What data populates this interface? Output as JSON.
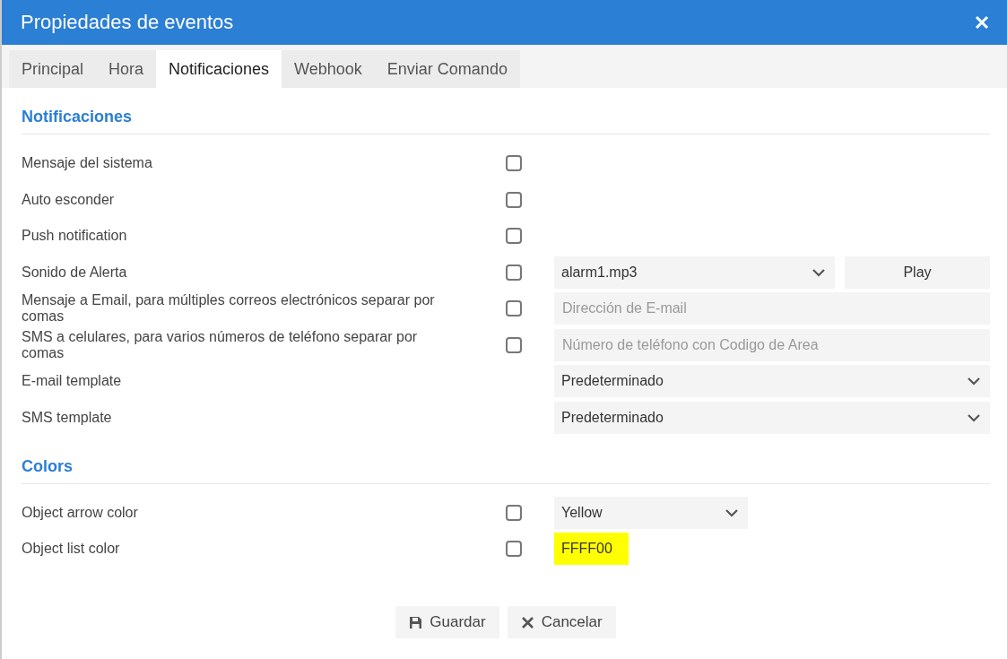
{
  "window": {
    "title": "Propiedades de eventos"
  },
  "tabs": [
    {
      "label": "Principal",
      "selected": false
    },
    {
      "label": "Hora",
      "selected": false
    },
    {
      "label": "Notificaciones",
      "selected": true
    },
    {
      "label": "Webhook",
      "selected": false
    },
    {
      "label": "Enviar Comando",
      "selected": false
    }
  ],
  "sections": [
    {
      "title": "Notificaciones",
      "rows": [
        {
          "label": "Mensaje del sistema",
          "checkbox": {
            "checked": false
          }
        },
        {
          "label": "Auto esconder",
          "checkbox": {
            "checked": false
          }
        },
        {
          "label": "Push notification",
          "checkbox": {
            "checked": false
          }
        },
        {
          "label": "Sonido de Alerta",
          "checkbox": {
            "checked": false
          },
          "control": {
            "kind": "select-button",
            "value": "alarm1.mp3",
            "button": "Play"
          }
        },
        {
          "label": "Mensaje a Email, para múltiples correos electrónicos separar por comas",
          "checkbox": {
            "checked": false
          },
          "control": {
            "kind": "input",
            "placeholder": "Dirección de E-mail"
          }
        },
        {
          "label": "SMS a celulares, para varios números de teléfono separar por comas",
          "checkbox": {
            "checked": false
          },
          "control": {
            "kind": "input",
            "placeholder": "Número de teléfono con Codigo de Area"
          }
        },
        {
          "label": "E-mail template",
          "control": {
            "kind": "select",
            "value": "Predeterminado"
          }
        },
        {
          "label": "SMS template",
          "control": {
            "kind": "select",
            "value": "Predeterminado"
          }
        }
      ]
    },
    {
      "title": "Colors",
      "rows": [
        {
          "label": "Object arrow color",
          "checkbox": {
            "checked": false
          },
          "control": {
            "kind": "short-select",
            "value": "Yellow"
          }
        },
        {
          "label": "Object list color",
          "checkbox": {
            "checked": false
          },
          "control": {
            "kind": "color",
            "value": "FFFF00",
            "color": "#ffff00"
          }
        }
      ]
    }
  ],
  "buttons": [
    {
      "kind": "save",
      "label": "Guardar"
    },
    {
      "kind": "cancel",
      "label": "Cancelar"
    }
  ]
}
